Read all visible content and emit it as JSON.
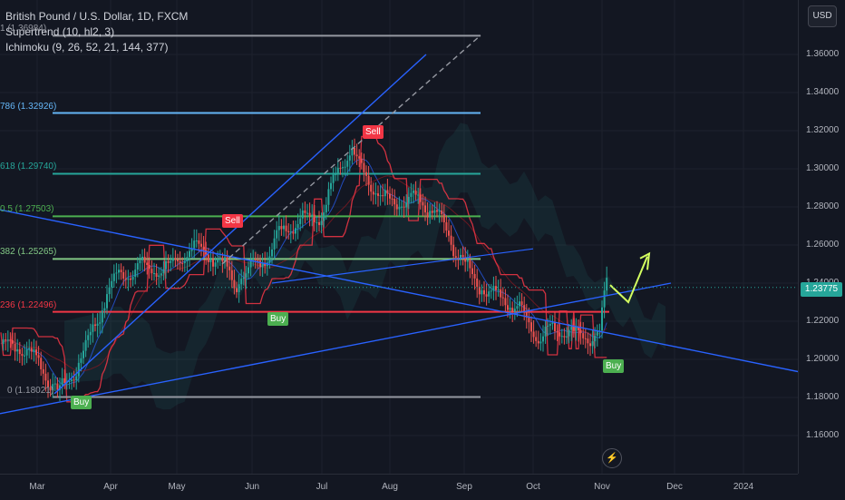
{
  "legend": {
    "symbol": "British Pound / U.S. Dollar, 1D, FXCM",
    "indicator1": "Supertrend (10, hl2, 3)",
    "indicator2": "Ichimoku (9, 26, 52, 21, 144, 377)"
  },
  "fib_levels": [
    {
      "label": "1 (1.36984)",
      "price": 1.36984,
      "color": "#9598a1"
    },
    {
      "label": "786 (1.32926)",
      "price": 1.32926,
      "color": "#64b5f6"
    },
    {
      "label": "618 (1.29740)",
      "price": 1.2974,
      "color": "#26a69a"
    },
    {
      "label": "0.5 (1.27503)",
      "price": 1.27503,
      "color": "#4caf50"
    },
    {
      "label": "382 (1.25265)",
      "price": 1.25265,
      "color": "#81c784"
    },
    {
      "label": "236 (1.22496)",
      "price": 1.22496,
      "color": "#f23645"
    },
    {
      "label": "0 (1.18021)",
      "price": 1.18021,
      "color": "#9598a1"
    }
  ],
  "price_scale": {
    "currency_button": "USD",
    "ticks": [
      "1.36000",
      "1.34000",
      "1.32000",
      "1.30000",
      "1.28000",
      "1.26000",
      "1.24000",
      "1.22000",
      "1.20000",
      "1.18000",
      "1.16000"
    ],
    "last_price": "1.23775"
  },
  "time_axis": {
    "months": [
      "Mar",
      "Apr",
      "May",
      "Jun",
      "Jul",
      "Aug",
      "Sep",
      "Oct",
      "Nov",
      "Dec",
      "2024"
    ]
  },
  "signals": {
    "buy_label": "Buy",
    "sell_label": "Sell"
  },
  "colors": {
    "background": "#131722",
    "up": "#26a69a",
    "down": "#ef5350",
    "trendline": "#2962ff",
    "supertrend_up": "#4caf50",
    "supertrend_down": "#f23645",
    "last_price": "#26a69a",
    "projection": "#d4ff60"
  },
  "chart_data": {
    "type": "candlestick",
    "symbol": "GBPUSD",
    "interval": "1D",
    "ylim": [
      1.15,
      1.375
    ],
    "last_price": 1.23775,
    "monthly_path": [
      {
        "date": "2023-03-01",
        "price": 1.195
      },
      {
        "date": "2023-03-10",
        "price": 1.185
      },
      {
        "date": "2023-04-01",
        "price": 1.235
      },
      {
        "date": "2023-04-15",
        "price": 1.245
      },
      {
        "date": "2023-05-08",
        "price": 1.262
      },
      {
        "date": "2023-05-25",
        "price": 1.235
      },
      {
        "date": "2023-06-15",
        "price": 1.275
      },
      {
        "date": "2023-07-01",
        "price": 1.27
      },
      {
        "date": "2023-07-14",
        "price": 1.312
      },
      {
        "date": "2023-08-01",
        "price": 1.285
      },
      {
        "date": "2023-08-20",
        "price": 1.272
      },
      {
        "date": "2023-09-01",
        "price": 1.255
      },
      {
        "date": "2023-09-25",
        "price": 1.22
      },
      {
        "date": "2023-10-03",
        "price": 1.208
      },
      {
        "date": "2023-10-15",
        "price": 1.222
      },
      {
        "date": "2023-10-31",
        "price": 1.213
      },
      {
        "date": "2023-11-03",
        "price": 1.238
      }
    ]
  }
}
